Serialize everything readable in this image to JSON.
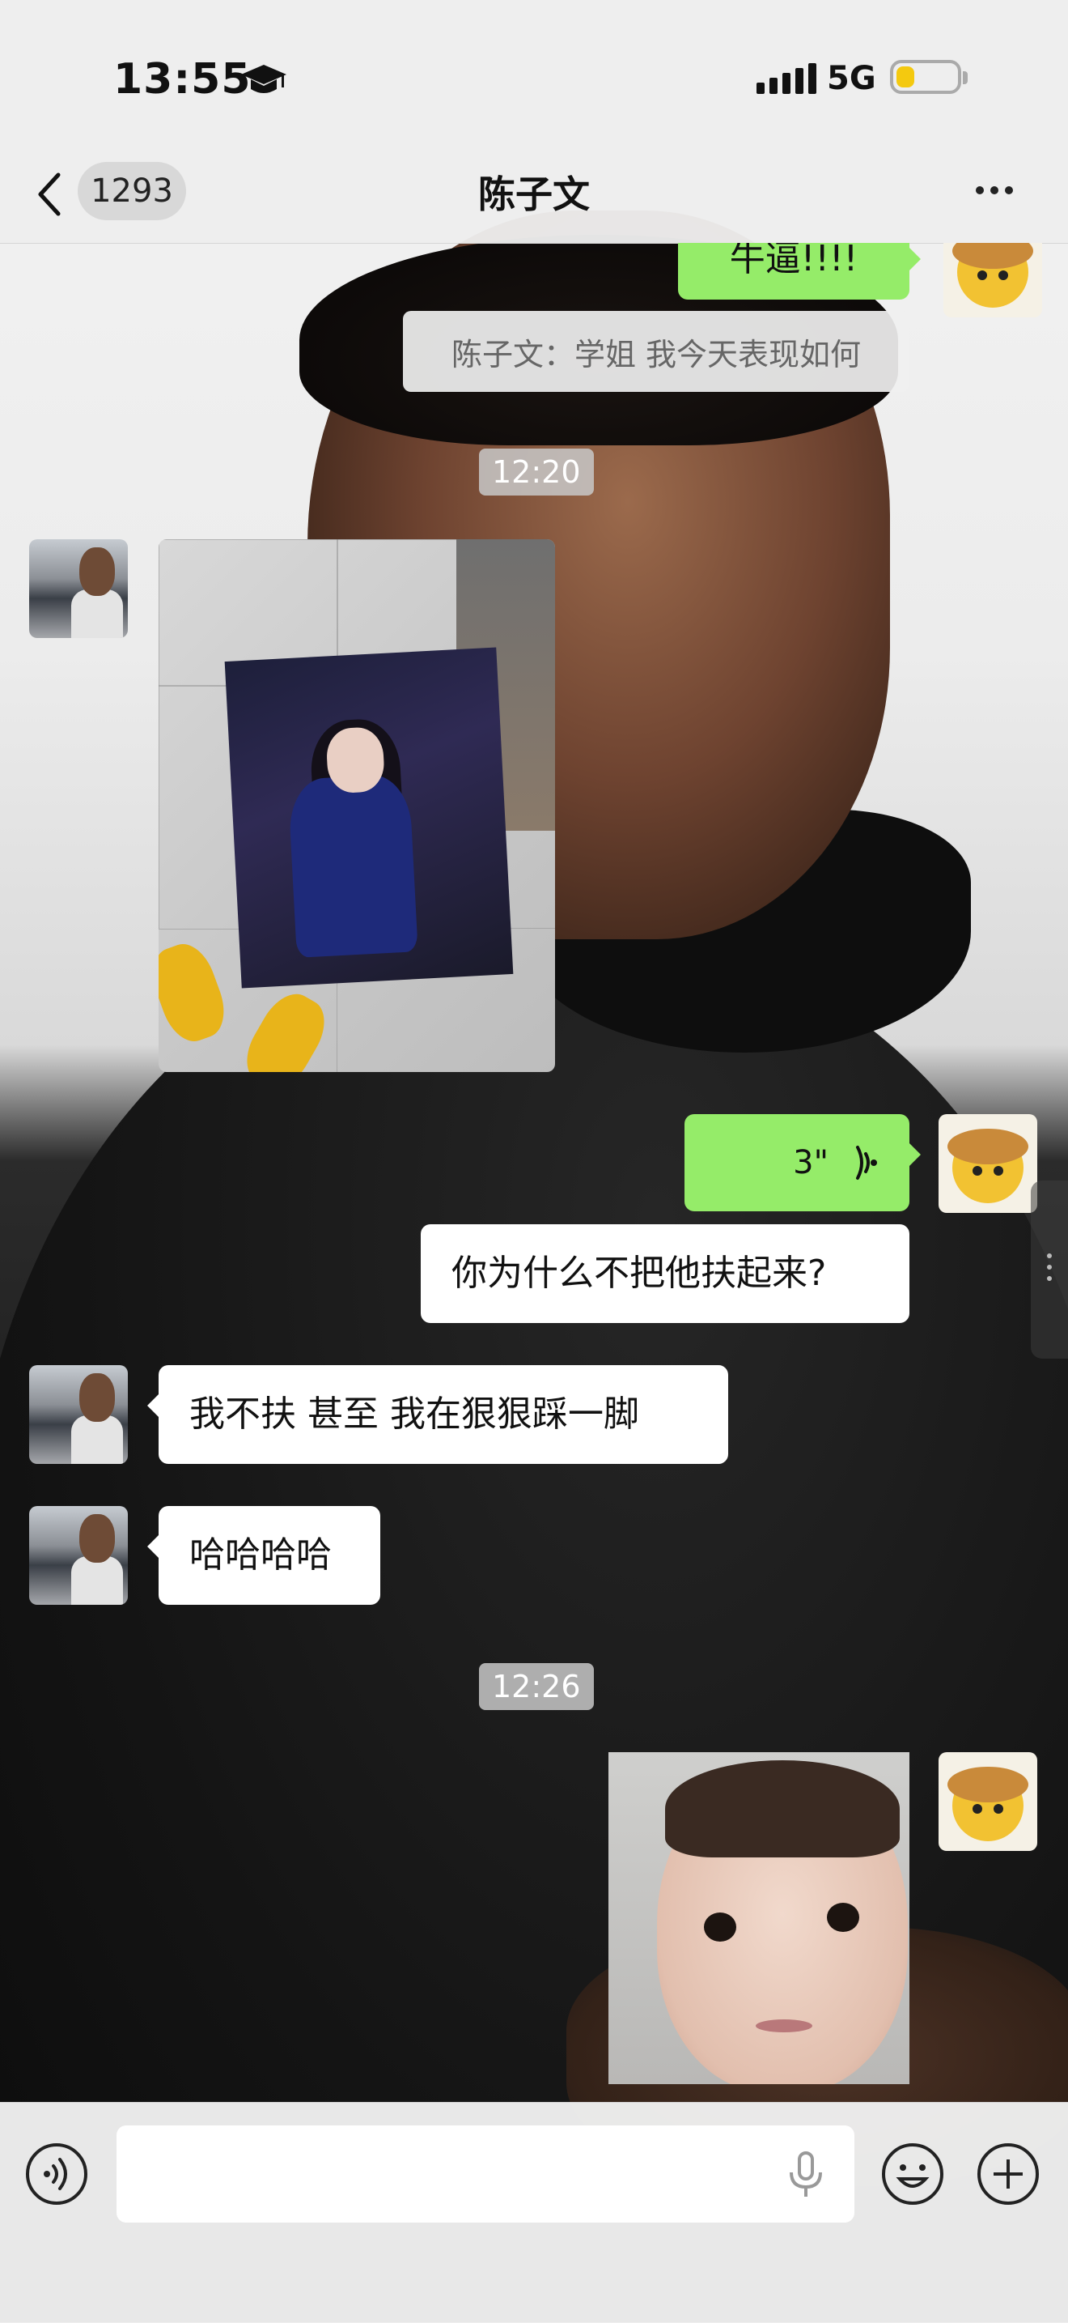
{
  "status_bar": {
    "time": "13:55",
    "network": "5G",
    "status_icon": "graduation-cap-icon",
    "battery_level": 0.3,
    "battery_color": "#f4c90f"
  },
  "nav": {
    "unread_count": "1293",
    "title": "陈子文"
  },
  "messages": {
    "top_partial": "牛逼!!!!",
    "quote": "陈子文：学姐 我今天表现如何",
    "time_1": "12:20",
    "voice_duration": "3\"",
    "reply": "你为什么不把他扶起来?",
    "msg_1": "我不扶 甚至 我在狠狠踩一脚",
    "msg_2": "哈哈哈哈",
    "time_2": "12:26"
  },
  "colors": {
    "bubble_green": "#95ec69",
    "bubble_white": "#ffffff",
    "bar_bg": "#ededed"
  }
}
